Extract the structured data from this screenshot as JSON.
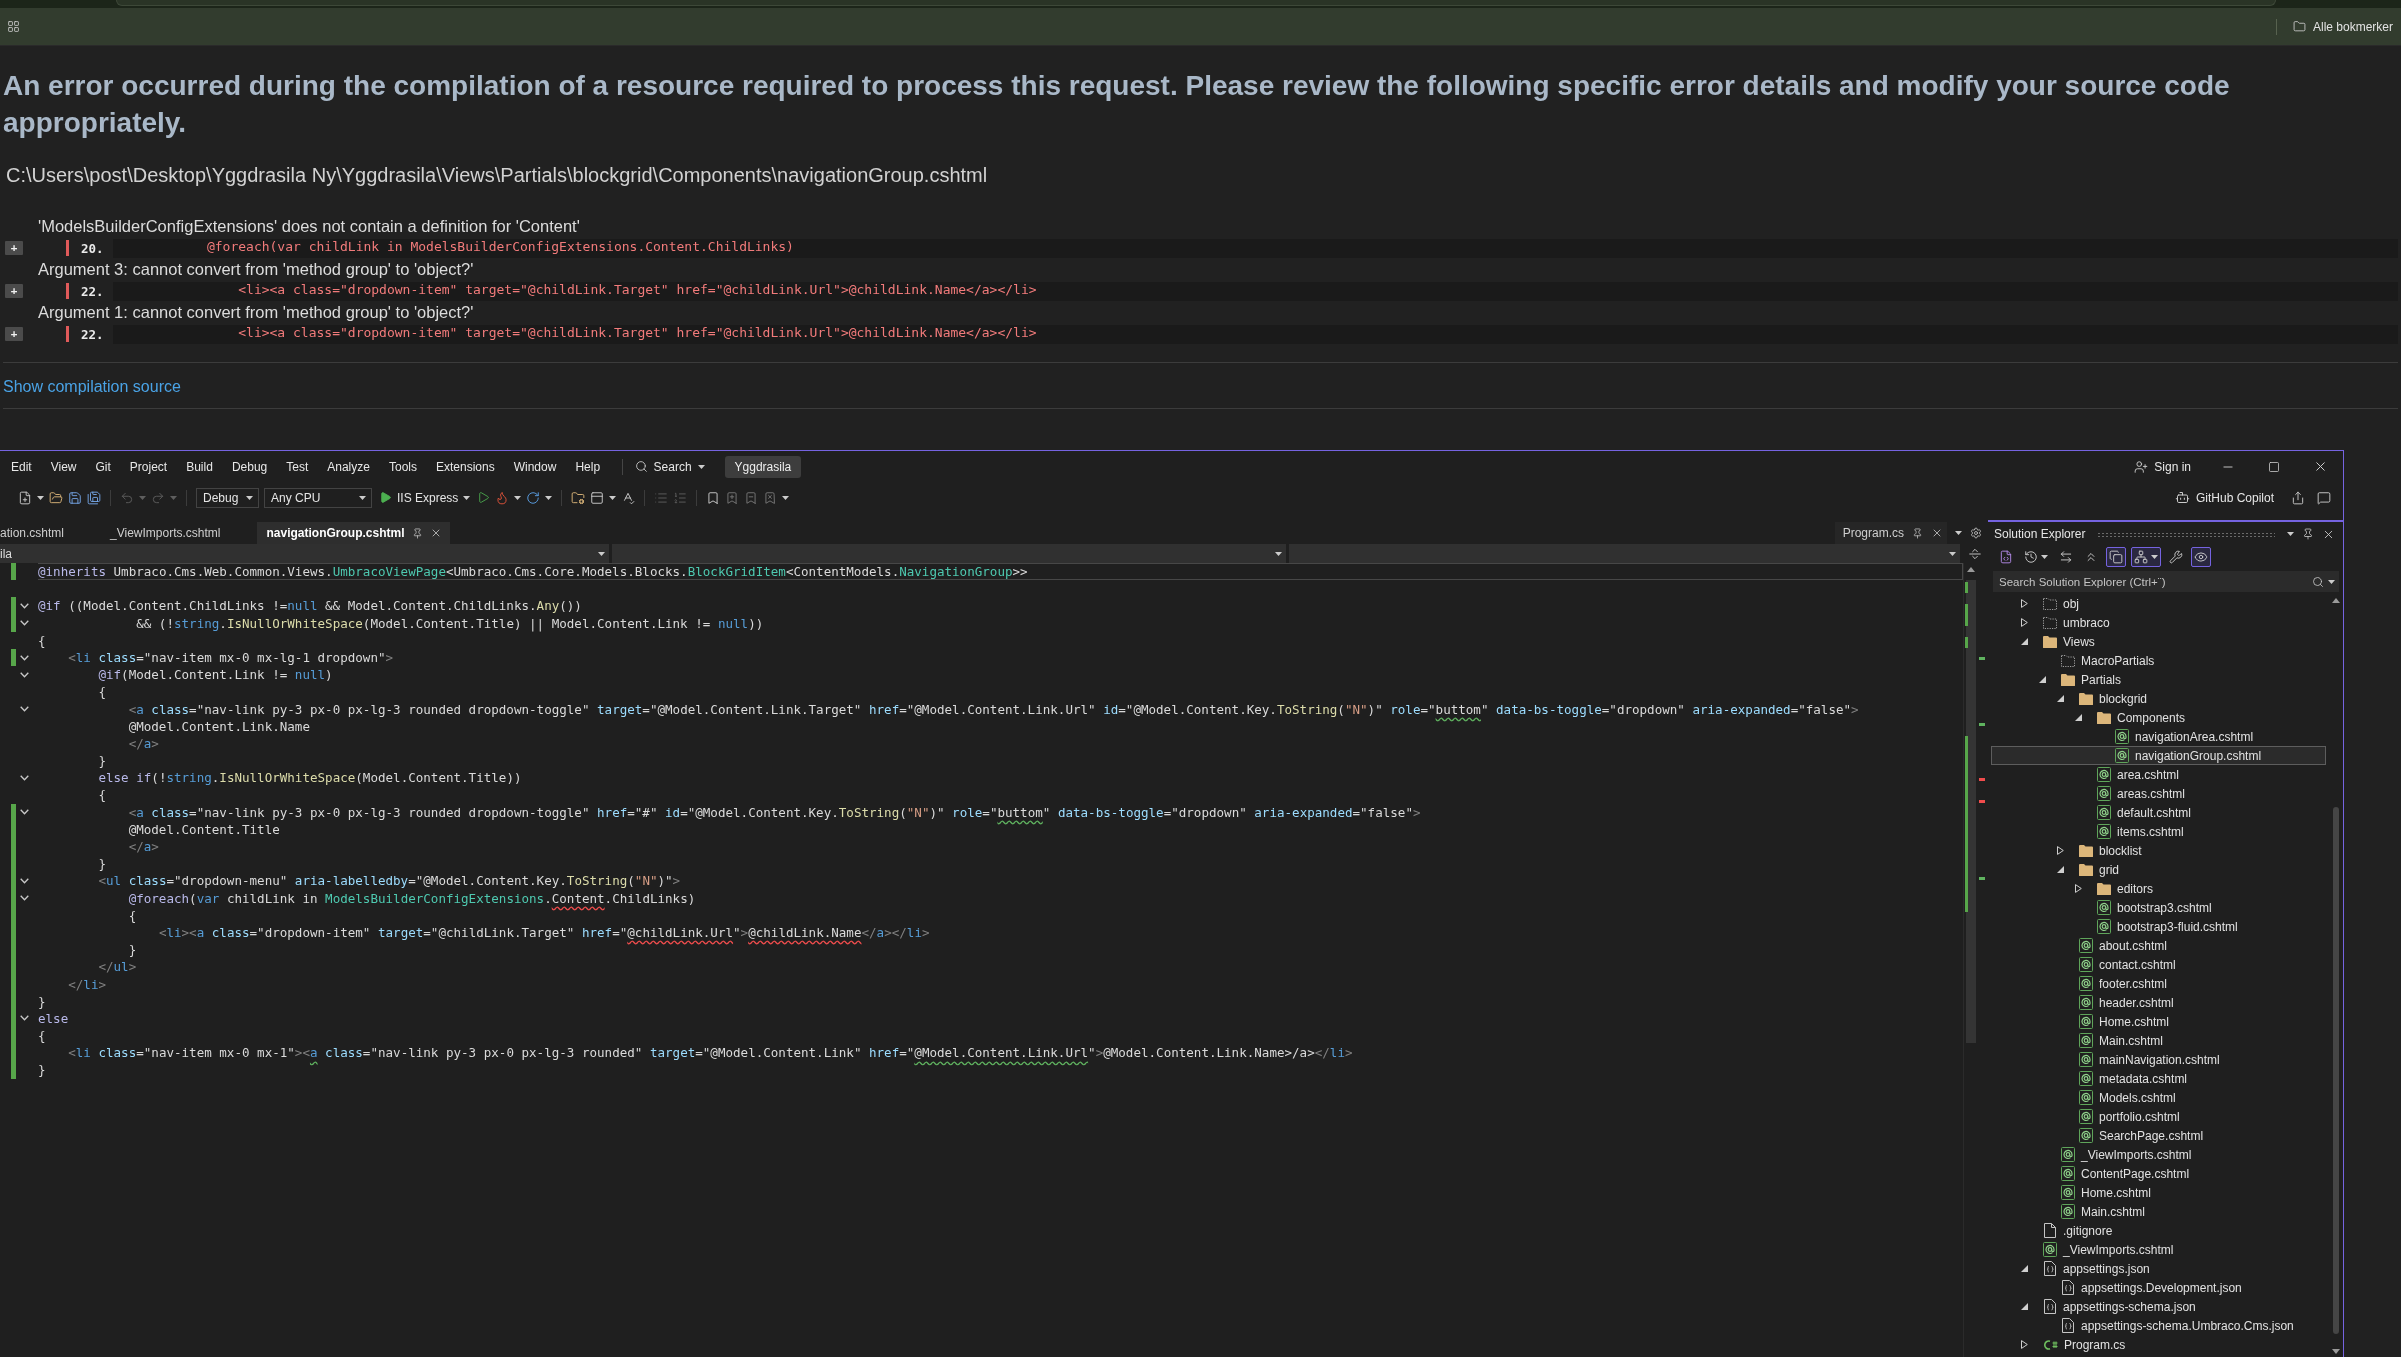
{
  "browser": {
    "bookmarks": "Alle bokmerker"
  },
  "error_page": {
    "heading": "An error occurred during the compilation of a resource required to process this request. Please review the following specific error details and modify your source code appropriately.",
    "file_path": "C:\\Users\\post\\Desktop\\Yggdrasila Ny\\Yggdrasila\\Views\\Partials\\blockgrid\\Components\\navigationGroup.cshtml",
    "errors": [
      {
        "message": "'ModelsBuilderConfigExtensions' does not contain a definition for 'Content'",
        "expand": "+",
        "line": "20.",
        "code": "            @foreach(var childLink in ModelsBuilderConfigExtensions.Content.ChildLinks)"
      },
      {
        "message": "Argument 3: cannot convert from 'method group' to 'object?'",
        "expand": "+",
        "line": "22.",
        "code": "                <li><a class=\"dropdown-item\" target=\"@childLink.Target\" href=\"@childLink.Url\">@childLink.Name</a></li>"
      },
      {
        "message": "Argument 1: cannot convert from 'method group' to 'object?'",
        "expand": "+",
        "line": "22.",
        "code": "                <li><a class=\"dropdown-item\" target=\"@childLink.Target\" href=\"@childLink.Url\">@childLink.Name</a></li>"
      }
    ],
    "link": "Show compilation source"
  },
  "ide": {
    "menu": [
      "Edit",
      "View",
      "Git",
      "Project",
      "Build",
      "Debug",
      "Test",
      "Analyze",
      "Tools",
      "Extensions",
      "Window",
      "Help"
    ],
    "search": "Search",
    "solution": "Yggdrasila",
    "sign_in": "Sign in",
    "toolbar": {
      "configuration": "Debug",
      "platform": "Any CPU",
      "run_target": "IIS Express",
      "copilot": "GitHub Copilot"
    },
    "tabs": [
      {
        "label": "ation.cshtml",
        "selected": false
      },
      {
        "label": "_ViewImports.cshtml",
        "selected": false
      },
      {
        "label": "navigationGroup.cshtml",
        "selected": true
      }
    ],
    "pinned_tab": {
      "label": "Program.cs",
      "selected": false
    },
    "navigation_bar": {
      "project": "ila"
    },
    "code_lines": [
      {
        "changed": true,
        "foldable": false,
        "current": true,
        "tokens": [
          {
            "kind": "razor",
            "text": "@inherits"
          },
          {
            "kind": "plain",
            "text": " Umbraco.Cms.Web.Common.Views."
          },
          {
            "kind": "type",
            "text": "UmbracoViewPage"
          },
          {
            "kind": "plain",
            "text": "<Umbraco.Cms.Core.Models.Blocks."
          },
          {
            "kind": "type",
            "text": "BlockGridItem"
          },
          {
            "kind": "plain",
            "text": "<ContentModels."
          },
          {
            "kind": "type",
            "text": "NavigationGroup"
          },
          {
            "kind": "plain",
            "text": ">>"
          }
        ]
      },
      {
        "changed": false,
        "foldable": false,
        "current": false
      },
      {
        "changed": true,
        "foldable": true,
        "current": false,
        "tokens": [
          {
            "kind": "razor",
            "text": "@if"
          },
          {
            "kind": "plain",
            "text": " ((Model.Content.ChildLinks !="
          },
          {
            "kind": "keyword",
            "text": "null"
          },
          {
            "kind": "plain",
            "text": " && Model.Content.ChildLinks."
          },
          {
            "kind": "method",
            "text": "Any"
          },
          {
            "kind": "plain",
            "text": "())"
          }
        ]
      },
      {
        "changed": true,
        "foldable": true,
        "current": false,
        "tokens": [
          {
            "kind": "plain",
            "text": "             && (!"
          },
          {
            "kind": "keyword",
            "text": "string"
          },
          {
            "kind": "plain",
            "text": "."
          },
          {
            "kind": "method",
            "text": "IsNullOrWhiteSpace"
          },
          {
            "kind": "plain",
            "text": "(Model.Content.Title) || Model.Content.Link != "
          },
          {
            "kind": "keyword",
            "text": "null"
          },
          {
            "kind": "plain",
            "text": "))"
          }
        ]
      },
      {
        "changed": false,
        "foldable": false,
        "current": false,
        "tokens": [
          {
            "kind": "plain",
            "text": "{"
          }
        ]
      },
      {
        "changed": true,
        "foldable": true,
        "current": false,
        "tokens": [
          {
            "kind": "punct",
            "text": "    <"
          },
          {
            "kind": "tag",
            "text": "li"
          },
          {
            "kind": "attr",
            "text": " class"
          },
          {
            "kind": "plain",
            "text": "=\"nav-item mx-0 mx-lg-1 dropdown\""
          },
          {
            "kind": "punct",
            "text": ">"
          }
        ]
      },
      {
        "changed": false,
        "foldable": true,
        "current": false,
        "tokens": [
          {
            "kind": "razor",
            "text": "        @if"
          },
          {
            "kind": "plain",
            "text": "(Model.Content.Link != "
          },
          {
            "kind": "keyword",
            "text": "null"
          },
          {
            "kind": "plain",
            "text": ")"
          }
        ]
      },
      {
        "changed": false,
        "foldable": false,
        "current": false,
        "tokens": [
          {
            "kind": "plain",
            "text": "        {"
          }
        ]
      },
      {
        "changed": false,
        "foldable": true,
        "current": false,
        "tokens": [
          {
            "kind": "punct",
            "text": "            <"
          },
          {
            "kind": "tag",
            "text": "a"
          },
          {
            "kind": "attr",
            "text": " class"
          },
          {
            "kind": "plain",
            "text": "=\"nav-link py-3 px-0 px-lg-3 rounded dropdown-toggle\""
          },
          {
            "kind": "attr",
            "text": " target"
          },
          {
            "kind": "plain",
            "text": "=\"@Model.Content.Link.Target\""
          },
          {
            "kind": "attr",
            "text": " href"
          },
          {
            "kind": "plain",
            "text": "=\"@Model.Content.Link.Url\""
          },
          {
            "kind": "attr",
            "text": " id"
          },
          {
            "kind": "plain",
            "text": "=\"@Model.Content.Key."
          },
          {
            "kind": "method",
            "text": "ToString"
          },
          {
            "kind": "plain",
            "text": "("
          },
          {
            "kind": "string",
            "text": "\"N\""
          },
          {
            "kind": "plain",
            "text": ")\""
          },
          {
            "kind": "attr",
            "text": " role"
          },
          {
            "kind": "plain",
            "text": "=\""
          },
          {
            "kind": "plain",
            "text": "buttom",
            "warning": true
          },
          {
            "kind": "plain",
            "text": "\""
          },
          {
            "kind": "attr",
            "text": " data-bs-toggle"
          },
          {
            "kind": "plain",
            "text": "=\"dropdown\""
          },
          {
            "kind": "attr",
            "text": " aria-expanded"
          },
          {
            "kind": "plain",
            "text": "=\"false\""
          },
          {
            "kind": "punct",
            "text": ">"
          }
        ]
      },
      {
        "changed": false,
        "foldable": false,
        "current": false,
        "tokens": [
          {
            "kind": "plain",
            "text": "            @Model.Content.Link.Name"
          }
        ]
      },
      {
        "changed": false,
        "foldable": false,
        "current": false,
        "tokens": [
          {
            "kind": "punct",
            "text": "            </"
          },
          {
            "kind": "tag",
            "text": "a"
          },
          {
            "kind": "punct",
            "text": ">"
          }
        ]
      },
      {
        "changed": false,
        "foldable": false,
        "current": false,
        "tokens": [
          {
            "kind": "plain",
            "text": "        }"
          }
        ]
      },
      {
        "changed": false,
        "foldable": true,
        "current": false,
        "tokens": [
          {
            "kind": "razor",
            "text": "        else if"
          },
          {
            "kind": "plain",
            "text": "(!"
          },
          {
            "kind": "keyword",
            "text": "string"
          },
          {
            "kind": "plain",
            "text": "."
          },
          {
            "kind": "method",
            "text": "IsNullOrWhiteSpace"
          },
          {
            "kind": "plain",
            "text": "(Model.Content.Title))"
          }
        ]
      },
      {
        "changed": false,
        "foldable": false,
        "current": false,
        "tokens": [
          {
            "kind": "plain",
            "text": "        {"
          }
        ]
      },
      {
        "changed": true,
        "foldable": true,
        "current": false,
        "tokens": [
          {
            "kind": "punct",
            "text": "            <"
          },
          {
            "kind": "tag",
            "text": "a"
          },
          {
            "kind": "attr",
            "text": " class"
          },
          {
            "kind": "plain",
            "text": "=\"nav-link py-3 px-0 px-lg-3 rounded dropdown-toggle\""
          },
          {
            "kind": "attr",
            "text": " href"
          },
          {
            "kind": "plain",
            "text": "=\"#\""
          },
          {
            "kind": "attr",
            "text": " id"
          },
          {
            "kind": "plain",
            "text": "=\"@Model.Content.Key."
          },
          {
            "kind": "method",
            "text": "ToString"
          },
          {
            "kind": "plain",
            "text": "("
          },
          {
            "kind": "string",
            "text": "\"N\""
          },
          {
            "kind": "plain",
            "text": ")\""
          },
          {
            "kind": "attr",
            "text": " role"
          },
          {
            "kind": "plain",
            "text": "=\""
          },
          {
            "kind": "plain",
            "text": "buttom",
            "warning": true
          },
          {
            "kind": "plain",
            "text": "\""
          },
          {
            "kind": "attr",
            "text": " data-bs-toggle"
          },
          {
            "kind": "plain",
            "text": "=\"dropdown\""
          },
          {
            "kind": "attr",
            "text": " aria-expanded"
          },
          {
            "kind": "plain",
            "text": "=\"false\""
          },
          {
            "kind": "punct",
            "text": ">"
          }
        ]
      },
      {
        "changed": true,
        "foldable": false,
        "current": false,
        "tokens": [
          {
            "kind": "plain",
            "text": "            @Model.Content.Title"
          }
        ]
      },
      {
        "changed": true,
        "foldable": false,
        "current": false,
        "tokens": [
          {
            "kind": "punct",
            "text": "            </"
          },
          {
            "kind": "tag",
            "text": "a"
          },
          {
            "kind": "punct",
            "text": ">"
          }
        ]
      },
      {
        "changed": true,
        "foldable": false,
        "current": false,
        "tokens": [
          {
            "kind": "plain",
            "text": "        }"
          }
        ]
      },
      {
        "changed": true,
        "foldable": true,
        "current": false,
        "tokens": [
          {
            "kind": "punct",
            "text": "        <"
          },
          {
            "kind": "tag",
            "text": "ul"
          },
          {
            "kind": "attr",
            "text": " class"
          },
          {
            "kind": "plain",
            "text": "=\"dropdown-menu\""
          },
          {
            "kind": "attr",
            "text": " aria-labelledby"
          },
          {
            "kind": "plain",
            "text": "=\"@Model.Content.Key."
          },
          {
            "kind": "method",
            "text": "ToString"
          },
          {
            "kind": "plain",
            "text": "("
          },
          {
            "kind": "string",
            "text": "\"N\""
          },
          {
            "kind": "plain",
            "text": ")\""
          },
          {
            "kind": "punct",
            "text": ">"
          }
        ]
      },
      {
        "changed": true,
        "foldable": true,
        "current": false,
        "tokens": [
          {
            "kind": "razor",
            "text": "            @foreach"
          },
          {
            "kind": "plain",
            "text": "("
          },
          {
            "kind": "keyword",
            "text": "var"
          },
          {
            "kind": "plain",
            "text": " childLink in "
          },
          {
            "kind": "type",
            "text": "ModelsBuilderConfigExtensions"
          },
          {
            "kind": "plain",
            "text": "."
          },
          {
            "kind": "plain",
            "text": "Content",
            "error": true
          },
          {
            "kind": "plain",
            "text": ".ChildLinks)"
          }
        ]
      },
      {
        "changed": true,
        "foldable": false,
        "current": false,
        "tokens": [
          {
            "kind": "plain",
            "text": "            {"
          }
        ]
      },
      {
        "changed": true,
        "foldable": false,
        "current": false,
        "tokens": [
          {
            "kind": "punct",
            "text": "                <"
          },
          {
            "kind": "tag",
            "text": "li"
          },
          {
            "kind": "punct",
            "text": "><"
          },
          {
            "kind": "tag",
            "text": "a"
          },
          {
            "kind": "attr",
            "text": " class"
          },
          {
            "kind": "plain",
            "text": "=\"dropdown-item\""
          },
          {
            "kind": "attr",
            "text": " target"
          },
          {
            "kind": "plain",
            "text": "=\"@childLink.Target\""
          },
          {
            "kind": "attr",
            "text": " href"
          },
          {
            "kind": "plain",
            "text": "=\""
          },
          {
            "kind": "plain",
            "text": "@childLink.Url",
            "error": true
          },
          {
            "kind": "plain",
            "text": "\""
          },
          {
            "kind": "punct",
            "text": ">"
          },
          {
            "kind": "plain",
            "text": "@childLink.Name",
            "error": true
          },
          {
            "kind": "punct",
            "text": "</"
          },
          {
            "kind": "tag",
            "text": "a"
          },
          {
            "kind": "punct",
            "text": "></"
          },
          {
            "kind": "tag",
            "text": "li"
          },
          {
            "kind": "punct",
            "text": ">"
          }
        ]
      },
      {
        "changed": true,
        "foldable": false,
        "current": false,
        "tokens": [
          {
            "kind": "plain",
            "text": "            }"
          }
        ]
      },
      {
        "changed": true,
        "foldable": false,
        "current": false,
        "tokens": [
          {
            "kind": "punct",
            "text": "        </"
          },
          {
            "kind": "tag",
            "text": "ul"
          },
          {
            "kind": "punct",
            "text": ">"
          }
        ]
      },
      {
        "changed": true,
        "foldable": false,
        "current": false,
        "tokens": [
          {
            "kind": "punct",
            "text": "    </"
          },
          {
            "kind": "tag",
            "text": "li"
          },
          {
            "kind": "punct",
            "text": ">"
          }
        ]
      },
      {
        "changed": true,
        "foldable": false,
        "current": false,
        "tokens": [
          {
            "kind": "plain",
            "text": "}"
          }
        ]
      },
      {
        "changed": true,
        "foldable": true,
        "current": false,
        "tokens": [
          {
            "kind": "razor",
            "text": "else"
          }
        ]
      },
      {
        "changed": true,
        "foldable": false,
        "current": false,
        "tokens": [
          {
            "kind": "plain",
            "text": "{"
          }
        ]
      },
      {
        "changed": true,
        "foldable": false,
        "current": false,
        "tokens": [
          {
            "kind": "punct",
            "text": "    <"
          },
          {
            "kind": "tag",
            "text": "li"
          },
          {
            "kind": "attr",
            "text": " class"
          },
          {
            "kind": "plain",
            "text": "=\"nav-item mx-0 mx-1\""
          },
          {
            "kind": "punct",
            "text": "><"
          },
          {
            "kind": "tag",
            "text": "a",
            "warning": true
          },
          {
            "kind": "attr",
            "text": " class"
          },
          {
            "kind": "plain",
            "text": "=\"nav-link py-3 px-0 px-lg-3 rounded\""
          },
          {
            "kind": "attr",
            "text": " target"
          },
          {
            "kind": "plain",
            "text": "=\"@Model.Content.Link\""
          },
          {
            "kind": "attr",
            "text": " href"
          },
          {
            "kind": "plain",
            "text": "=\""
          },
          {
            "kind": "plain",
            "text": "@Model.Content.Link.Url",
            "warning": true
          },
          {
            "kind": "plain",
            "text": "\""
          },
          {
            "kind": "punct",
            "text": ">"
          },
          {
            "kind": "plain",
            "text": "@Model.Content.Link.Name>/a>"
          },
          {
            "kind": "punct",
            "text": "</"
          },
          {
            "kind": "tag",
            "text": "li"
          },
          {
            "kind": "punct",
            "text": ">"
          }
        ]
      },
      {
        "changed": true,
        "foldable": false,
        "current": false,
        "tokens": [
          {
            "kind": "plain",
            "text": "}"
          }
        ]
      }
    ],
    "solution_explorer": {
      "title": "Solution Explorer",
      "toolbar": [
        {
          "kind": "home",
          "on": false
        },
        {
          "kind": "history",
          "on": false
        },
        {
          "kind": "sync",
          "on": false
        },
        {
          "kind": "collapse",
          "on": false
        },
        {
          "kind": "show-all",
          "on": true
        },
        {
          "kind": "tree",
          "on": true
        },
        {
          "kind": "properties",
          "on": false
        },
        {
          "kind": "preview",
          "on": true
        }
      ],
      "search_placeholder": "Search Solution Explorer (Ctrl+¨)",
      "tree": [
        {
          "label": "obj",
          "kind": "excluded-folder",
          "expanded": false,
          "selected": false
        },
        {
          "label": "umbraco",
          "kind": "excluded-folder",
          "expanded": false,
          "selected": false
        },
        {
          "label": "Views",
          "kind": "folder",
          "expanded": true,
          "selected": false,
          "children": [
            {
              "label": "MacroPartials",
              "kind": "excluded-folder",
              "selected": false
            },
            {
              "label": "Partials",
              "kind": "folder",
              "expanded": true,
              "selected": false,
              "children": [
                {
                  "label": "blockgrid",
                  "kind": "folder",
                  "expanded": true,
                  "selected": false,
                  "children": [
                    {
                      "label": "Components",
                      "kind": "folder",
                      "expanded": true,
                      "selected": false,
                      "children": [
                        {
                          "label": "navigationArea.cshtml",
                          "kind": "razor",
                          "selected": false
                        },
                        {
                          "label": "navigationGroup.cshtml",
                          "kind": "razor",
                          "selected": true
                        }
                      ]
                    },
                    {
                      "label": "area.cshtml",
                      "kind": "razor",
                      "selected": false
                    },
                    {
                      "label": "areas.cshtml",
                      "kind": "razor",
                      "selected": false
                    },
                    {
                      "label": "default.cshtml",
                      "kind": "razor",
                      "selected": false
                    },
                    {
                      "label": "items.cshtml",
                      "kind": "razor",
                      "selected": false
                    }
                  ]
                },
                {
                  "label": "blocklist",
                  "kind": "folder",
                  "expanded": false,
                  "selected": false
                },
                {
                  "label": "grid",
                  "kind": "folder",
                  "expanded": true,
                  "selected": false,
                  "children": [
                    {
                      "label": "editors",
                      "kind": "folder",
                      "expanded": false,
                      "selected": false
                    },
                    {
                      "label": "bootstrap3.cshtml",
                      "kind": "razor",
                      "selected": false
                    },
                    {
                      "label": "bootstrap3-fluid.cshtml",
                      "kind": "razor",
                      "selected": false
                    }
                  ]
                },
                {
                  "label": "about.cshtml",
                  "kind": "razor",
                  "selected": false
                },
                {
                  "label": "contact.cshtml",
                  "kind": "razor",
                  "selected": false
                },
                {
                  "label": "footer.cshtml",
                  "kind": "razor",
                  "selected": false
                },
                {
                  "label": "header.cshtml",
                  "kind": "razor",
                  "selected": false
                },
                {
                  "label": "Home.cshtml",
                  "kind": "razor",
                  "selected": false
                },
                {
                  "label": "Main.cshtml",
                  "kind": "razor",
                  "selected": false
                },
                {
                  "label": "mainNavigation.cshtml",
                  "kind": "razor",
                  "selected": false
                },
                {
                  "label": "metadata.cshtml",
                  "kind": "razor",
                  "selected": false
                },
                {
                  "label": "Models.cshtml",
                  "kind": "razor",
                  "selected": false
                },
                {
                  "label": "portfolio.cshtml",
                  "kind": "razor",
                  "selected": false
                },
                {
                  "label": "SearchPage.cshtml",
                  "kind": "razor",
                  "selected": false
                }
              ]
            },
            {
              "label": "_ViewImports.cshtml",
              "kind": "razor",
              "selected": false
            },
            {
              "label": "ContentPage.cshtml",
              "kind": "razor",
              "selected": false
            },
            {
              "label": "Home.cshtml",
              "kind": "razor",
              "selected": false
            },
            {
              "label": "Main.cshtml",
              "kind": "razor",
              "selected": false
            }
          ]
        },
        {
          "label": ".gitignore",
          "kind": "text",
          "selected": false
        },
        {
          "label": "_ViewImports.cshtml",
          "kind": "razor",
          "selected": false
        },
        {
          "label": "appsettings.json",
          "kind": "json",
          "expanded": true,
          "selected": false,
          "children": [
            {
              "label": "appsettings.Development.json",
              "kind": "json",
              "selected": false
            }
          ]
        },
        {
          "label": "appsettings-schema.json",
          "kind": "json",
          "expanded": true,
          "selected": false,
          "children": [
            {
              "label": "appsettings-schema.Umbraco.Cms.json",
              "kind": "json",
              "selected": false
            }
          ]
        },
        {
          "label": "Program.cs",
          "kind": "csharp",
          "expanded": false,
          "selected": false
        }
      ]
    }
  }
}
